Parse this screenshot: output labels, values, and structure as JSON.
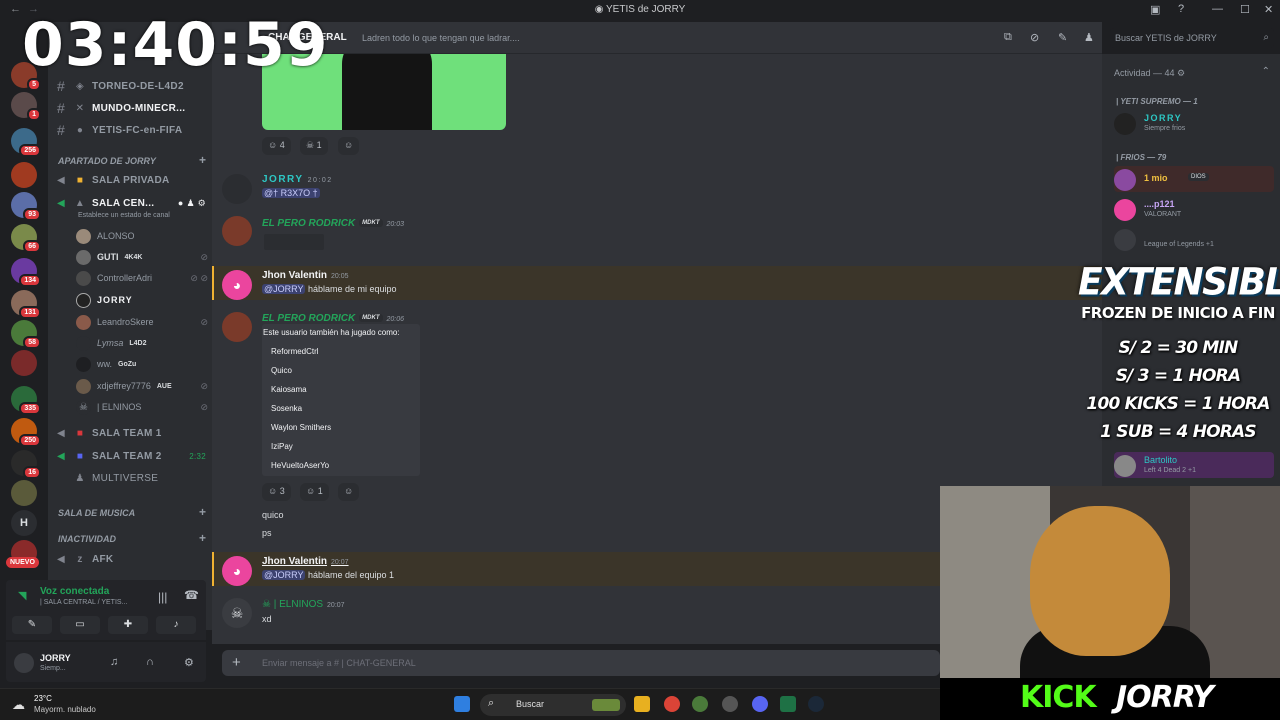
{
  "window": {
    "title": "YETIS de JORRY"
  },
  "rail": {
    "badges": [
      "5",
      "1",
      "256",
      "93",
      "66",
      "134",
      "131",
      "58",
      "335",
      "250",
      "16"
    ],
    "new_label": "NUEVO",
    "letter": "H"
  },
  "sidebar": {
    "text_channels": [
      "TORNEO-DE-L4D2",
      "MUNDO-MINECR...",
      "YETIS-FC-en-FIFA"
    ],
    "category_jorry": "APARTADO DE JORRY",
    "voice_channels": [
      {
        "name": "SALA PRIVADA"
      },
      {
        "name": "SALA CEN...",
        "status": "Establece un estado de canal"
      }
    ],
    "voice_users": [
      {
        "name": "ALONSO"
      },
      {
        "name": "GUTI",
        "tag": "4K4K"
      },
      {
        "name": "ControllerAdri"
      },
      {
        "name": "JORRY"
      },
      {
        "name": "LeandroSkere"
      },
      {
        "name": "Lymsa",
        "tag": "L4D2"
      },
      {
        "name": "ww.",
        "tag": "GoZu"
      },
      {
        "name": "xdjeffrey7776",
        "tag": "AUE"
      },
      {
        "name": "| ELNINOS"
      }
    ],
    "team_channels": [
      {
        "name": "SALA TEAM 1",
        "time": ""
      },
      {
        "name": "SALA TEAM 2",
        "time": "2:32"
      },
      {
        "name": "MULTIVERSE",
        "time": ""
      }
    ],
    "category_musica": "SALA DE MUSICA",
    "category_inactividad": "INACTIVIDAD",
    "afk": "AFK"
  },
  "voice_panel": {
    "status": "Voz conectada",
    "location": "| SALA CENTRAL / YETIS..."
  },
  "user_panel": {
    "name": "JORRY",
    "status": "Siemp..."
  },
  "header": {
    "channel": "CHAT-GENERAL",
    "topic": "Ladren todo lo que tengan que ladrar....",
    "search_placeholder": "Buscar YETIS de JORRY"
  },
  "messages": {
    "reactions_top": [
      "4",
      "1"
    ],
    "m1": {
      "author": "JORRY",
      "time": "20:02",
      "text": "@† R3X7O †"
    },
    "m2": {
      "author": "EL PERO RODRICK",
      "role": "MDKT",
      "time": "20:03"
    },
    "m3": {
      "author": "Jhon Valentin",
      "time": "20:05",
      "mention": "@JORRY",
      "text": "háblame de mi equipo"
    },
    "m4": {
      "author": "EL PERO RODRICK",
      "role": "MDKT",
      "time": "20:06",
      "card_title": "Este usuario también ha jugado como:",
      "aliases": [
        "ReformedCtrl",
        "Quico",
        "Kaiosama",
        "Sosenka",
        "Waylon Smithers",
        "IziPay",
        "HeVueltoAserYo"
      ],
      "reactions": [
        "3",
        "1"
      ],
      "followups": [
        "quico",
        "ps"
      ]
    },
    "m5": {
      "author": "Jhon Valentin",
      "time": "20:07",
      "mention": "@JORRY",
      "text": "háblame del equipo 1"
    },
    "m6": {
      "author": "| ELNINOS",
      "time": "20:07",
      "text": "xd"
    }
  },
  "composer": {
    "placeholder": "Enviar mensaje a #  | CHAT-GENERAL"
  },
  "members": {
    "activity": "Actividad — 44",
    "group1": "| YETI SUPREMO — 1",
    "group2": "| FRIOS — 79",
    "list": [
      {
        "name": "JORRY",
        "status": "Siempre frios",
        "color": "#2dc7c4"
      },
      {
        "name": "1 mio",
        "status": "",
        "tag": "DIOS",
        "color": "#f0c040"
      },
      {
        "name": "....p121",
        "status": "VALORANT",
        "color": "#c7a6f5"
      },
      {
        "name": "",
        "status": "League of Legends +1",
        "color": "#c7a6f5"
      },
      {
        "name": "Bartolito",
        "status": "Left 4 Dead 2 +1",
        "color": "#2dc7c4"
      }
    ]
  },
  "stream": {
    "timer": "03:40:59",
    "promo_title": "EXTENSIBLE",
    "promo_subtitle": "FROZEN DE INICIO A FIN",
    "promo_lines": [
      "S/ 2 = 30 MIN",
      "S/ 3 = 1 HORA",
      "100 KICKS = 1 HORA",
      "1 SUB = 4 HORAS"
    ],
    "kick_label": "KICK",
    "kick_name": "JORRY"
  },
  "taskbar": {
    "temperature": "23°C",
    "weather": "Mayorm. nublado",
    "search": "Buscar"
  },
  "colors": {
    "accent_green": "#23a55a",
    "mention_bg": "#3c4270",
    "kick_green": "#53fc18",
    "red_badge": "#da373c"
  }
}
